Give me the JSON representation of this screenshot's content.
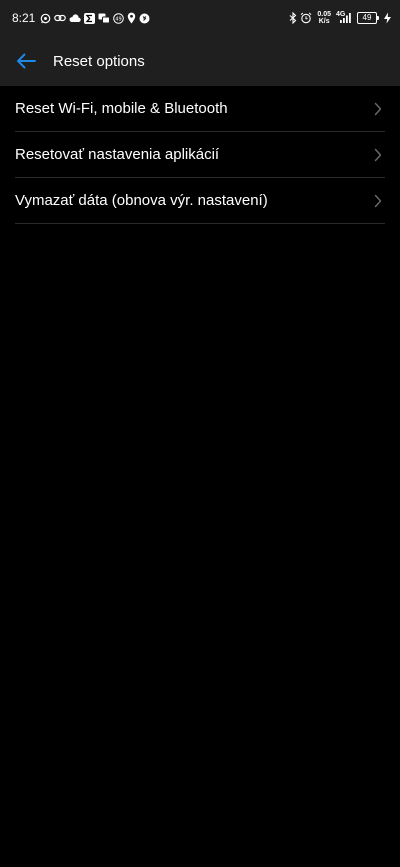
{
  "status_bar": {
    "time": "8:21",
    "net_speed_value": "0.05",
    "net_speed_unit": "K/s",
    "network_type": "4G",
    "battery_level": "49",
    "left_icons": [
      "whatsapp-icon",
      "link-icon",
      "cloud-icon",
      "sigma-icon",
      "chat-icon",
      "badge-icon",
      "location-icon",
      "shazam-icon"
    ],
    "right_icons": [
      "bluetooth-icon",
      "alarm-icon",
      "net-speed",
      "signal-icon",
      "battery-icon",
      "charging-icon"
    ]
  },
  "header": {
    "title": "Reset options",
    "back_icon": "back-arrow-icon",
    "accent_color": "#1e88e5"
  },
  "options": [
    {
      "label": "Reset Wi-Fi, mobile & Bluetooth"
    },
    {
      "label": "Resetovať nastavenia aplikácií"
    },
    {
      "label": "Vymazať dáta (obnova výr. nastavení)"
    }
  ]
}
